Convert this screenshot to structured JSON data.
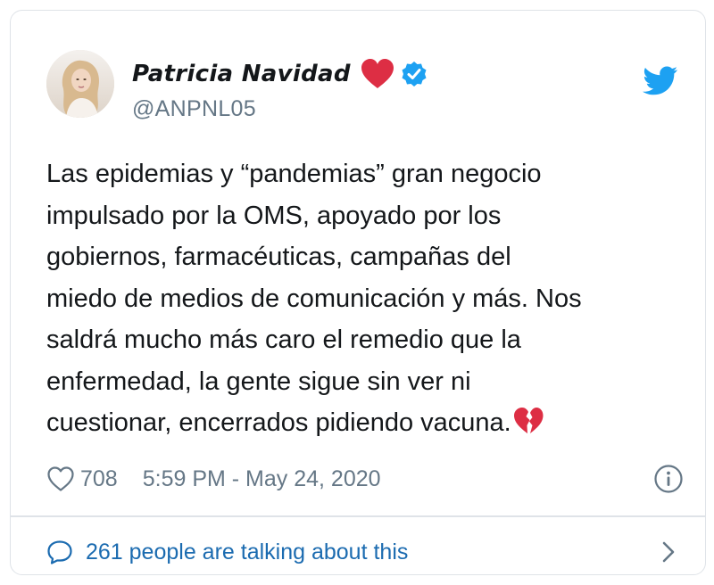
{
  "tweet": {
    "author": {
      "display_name": "Patricia Navidad",
      "handle": "@ANPNL05"
    },
    "text": "Las epidemias y “pandemias” gran negocio\nimpulsado por la OMS, apoyado por los\ngobiernos, farmacéuticas, campañas del\nmiedo de medios de comunicación y más. Nos\nsaldrá mucho más caro el remedio que la\nenfermedad, la gente sigue sin ver ni\ncuestionar, encerrados pidiendo vacuna.",
    "likes": "708",
    "timestamp": "5:59 PM - May 24, 2020",
    "conversation": "261 people are talking about this"
  },
  "icons": {
    "heart": "red-heart-emoji",
    "verified": "verified-badge",
    "twitter": "twitter-bird",
    "broken_heart": "broken-heart-emoji",
    "like": "heart-outline",
    "info": "info-circle",
    "comment": "speech-bubble",
    "chevron": "chevron-right"
  },
  "colors": {
    "verified_blue": "#1da1f2",
    "link_blue": "#1b6bb0",
    "muted_gray": "#657786",
    "heart_red": "#dd2e44"
  }
}
